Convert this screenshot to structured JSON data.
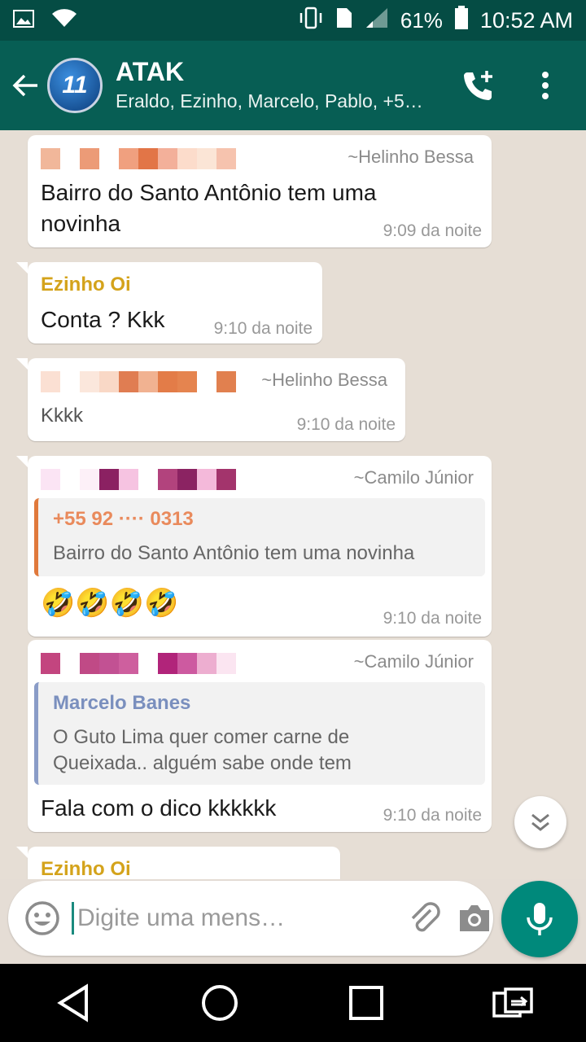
{
  "status_bar": {
    "battery": "61%",
    "time": "10:52 AM"
  },
  "header": {
    "avatar_text": "11",
    "title": "ATAK",
    "subtitle": "Eraldo, Ezinho, Marcelo, Pablo, +5…"
  },
  "messages": [
    {
      "author": "~Helinho Bessa",
      "text_line1": "Bairro do Santo Antônio tem uma",
      "text_line2": "novinha",
      "time": "9:09 da noite"
    },
    {
      "sender": "Ezinho Oi",
      "text": "Conta ? Kkk",
      "time": "9:10 da noite"
    },
    {
      "author": "~Helinho Bessa",
      "text": "Kkkk",
      "time": "9:10 da noite"
    },
    {
      "author": "~Camilo Júnior",
      "quote_name": "+55 92 ···· 0313",
      "quote_text": "Bairro do Santo Antônio tem uma novinha",
      "text": "🤣🤣🤣🤣",
      "time": "9:10 da noite"
    },
    {
      "author": "~Camilo Júnior",
      "quote_name": "Marcelo Banes",
      "quote_line1": "O Guto Lima quer comer carne de",
      "quote_line2": "Queixada.. alguém sabe onde tem",
      "text": "Fala com o dico kkkkkk",
      "time": "9:10 da noite"
    },
    {
      "sender": "Ezinho Oi"
    }
  ],
  "input": {
    "placeholder": "Digite uma mens…"
  },
  "colors": {
    "header": "#075e54",
    "status": "#054c44",
    "accent": "#00897b",
    "sender_yellow": "#d4a31b",
    "quote_blue": "#8a9cc7",
    "quote_orange": "#e0793b"
  }
}
